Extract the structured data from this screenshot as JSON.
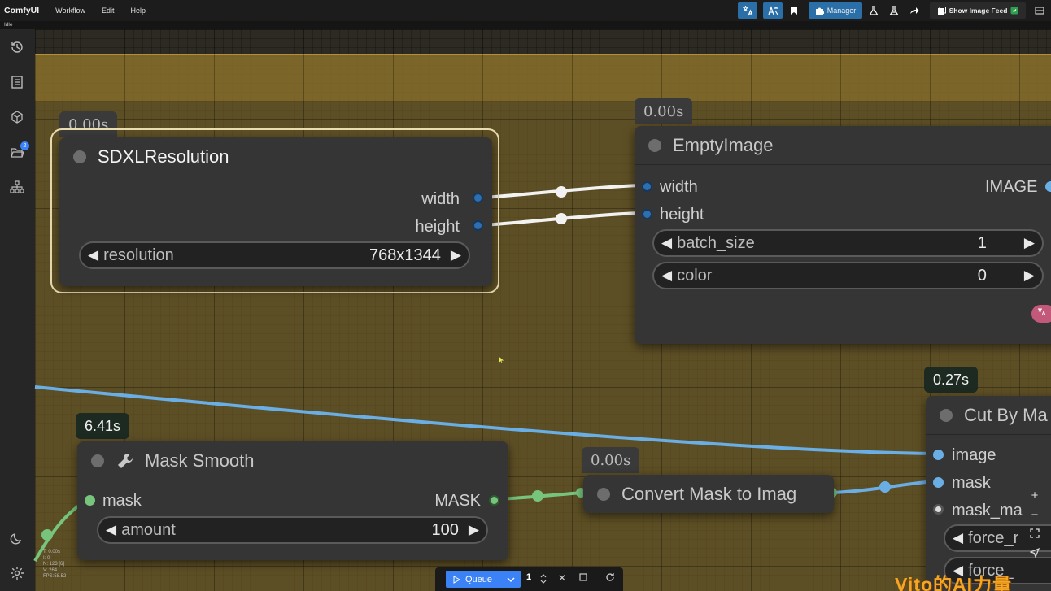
{
  "app": {
    "name": "ComfyUI",
    "status": "Idle"
  },
  "menu": [
    "Workflow",
    "Edit",
    "Help"
  ],
  "toolbar": {
    "manager_label": "Manager",
    "image_feed_label": "Show Image Feed"
  },
  "queue": {
    "button_label": "Queue",
    "count": "1"
  },
  "stats": {
    "t": "T: 0.00s",
    "i": "I: 0",
    "n": "N: 123 [6]",
    "v": "V: 264",
    "fps": "FPS:58.52"
  },
  "watermark": "Vito的AI力量",
  "nodes": {
    "sdxl": {
      "timer": "0.00s",
      "title": "SDXLResolution",
      "outputs": [
        "width",
        "height"
      ],
      "widget": {
        "label": "resolution",
        "value": "768x1344"
      }
    },
    "empty_image": {
      "timer": "0.00s",
      "title": "EmptyImage",
      "inputs": [
        "width",
        "height"
      ],
      "output": "IMAGE",
      "widgets": [
        {
          "label": "batch_size",
          "value": "1"
        },
        {
          "label": "color",
          "value": "0"
        }
      ]
    },
    "mask_smooth": {
      "timer": "6.41s",
      "title": "Mask Smooth",
      "input": "mask",
      "output": "MASK",
      "widget": {
        "label": "amount",
        "value": "100"
      }
    },
    "convert_mask": {
      "timer": "0.00s",
      "title": "Convert Mask to Imag"
    },
    "cut_by_mask": {
      "timer": "0.27s",
      "title": "Cut By Ma",
      "inputs": [
        "image",
        "mask",
        "mask_ma"
      ],
      "widgets": [
        "force_r",
        "force_"
      ]
    }
  },
  "colors": {
    "image_link": "#6aaee6",
    "mask_link": "#77c47d",
    "int_link": "#f2f2f2",
    "accent_blue": "#2a6fa8",
    "group_gold": "#8a7028"
  }
}
